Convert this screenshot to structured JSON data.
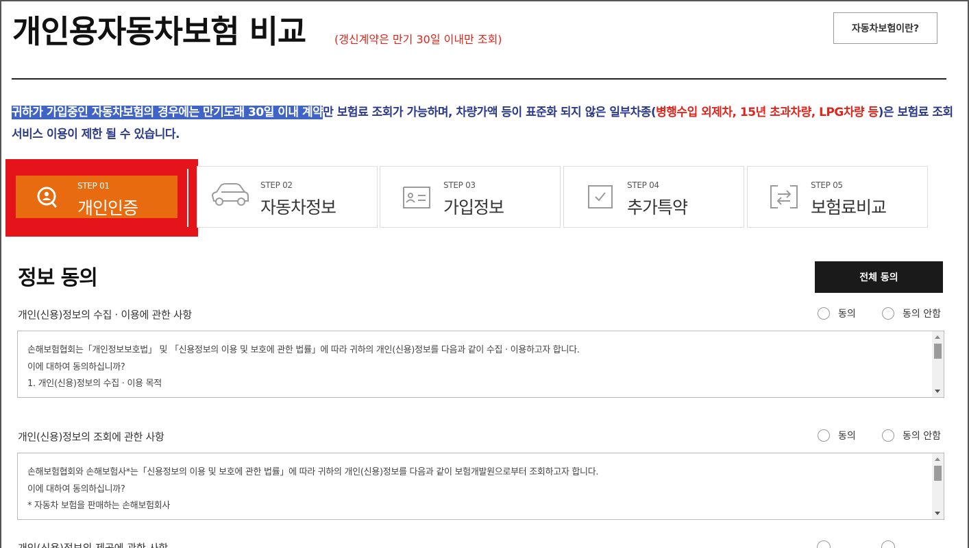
{
  "header": {
    "title": "개인용자동차보험 비교",
    "subtitle": "(갱신계약은 만기 30일 이내만 조회)",
    "about_button": "자동차보험이란?"
  },
  "notice": {
    "highlighted": "귀하가 가입중인 자동차보험의 경우에는 만기도래 30일 이내 계약",
    "text_1": "만 보험료 조회가 가능하며, 차량가액 등이 표준화 되지 않은 일부차종(",
    "red": "병행수입 외제차, 15년 초과차량, LPG차량 등",
    "text_2": ")은 보험료 조회서비스 이용이 제한 될 수 있습니다."
  },
  "steps": [
    {
      "num": "STEP 01",
      "name": "개인인증",
      "icon": "search-person-icon",
      "active": true
    },
    {
      "num": "STEP 02",
      "name": "자동차정보",
      "icon": "car-icon",
      "active": false
    },
    {
      "num": "STEP 03",
      "name": "가입정보",
      "icon": "id-card-icon",
      "active": false
    },
    {
      "num": "STEP 04",
      "name": "추가특약",
      "icon": "checkbox-icon",
      "active": false
    },
    {
      "num": "STEP 05",
      "name": "보험료비교",
      "icon": "compare-arrows-icon",
      "active": false
    }
  ],
  "consent": {
    "title": "정보 동의",
    "agree_all": "전체 동의",
    "agree_label": "동의",
    "disagree_label": "동의 안함",
    "items": [
      {
        "label": "개인(신용)정보의 수집 · 이용에 관한 사항",
        "lines": [
          "손해보험협회는「개인정보보호법」 및 「신용정보의 이용 및 보호에 관한 법률」에 따라 귀하의 개인(신용)정보를 다음과 같이 수집 · 이용하고자 합니다.",
          "이에 대하여 동의하십니까?",
          "1. 개인(신용)정보의 수집 · 이용 목적"
        ]
      },
      {
        "label": "개인(신용)정보의 조회에 관한 사항",
        "lines": [
          "손해보험협회와 손해보험사*는「신용정보의 이용 및 보호에 관한 법률」에 따라 귀하의 개인(신용)정보를 다음과 같이 보험개발원으로부터 조회하고자 합니다.",
          "이에 대하여 동의하십니까?",
          "* 자동차 보험을 판매하는 손해보험회사"
        ]
      },
      {
        "label": "개인(신용)정보의 제공에 관한 사항"
      }
    ]
  },
  "colors": {
    "accent_orange": "#e96b10",
    "highlight_red": "#e5141b",
    "notice_blue": "#2b3a8c",
    "selection_blue": "#3f63c6"
  }
}
